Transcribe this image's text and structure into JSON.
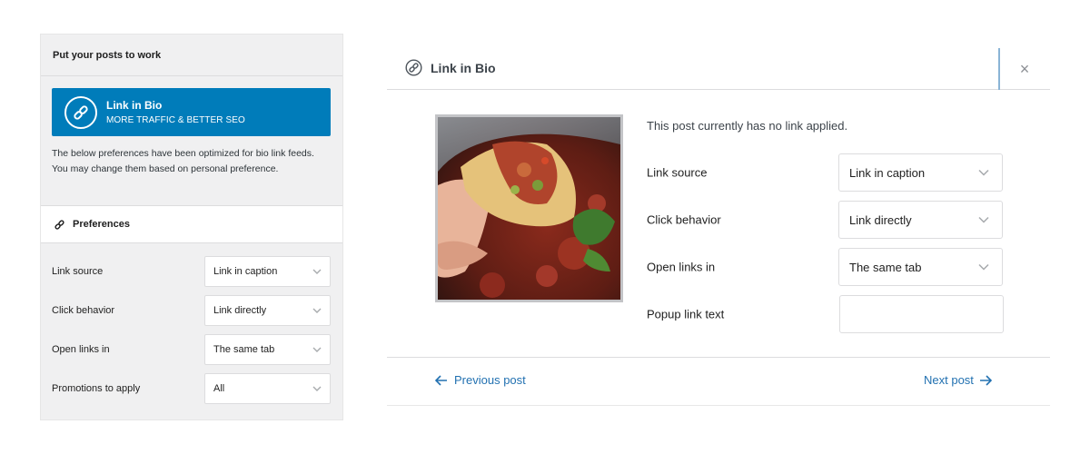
{
  "left_panel": {
    "title": "Put your posts to work",
    "promo": {
      "title": "Link in Bio",
      "subtitle": "MORE TRAFFIC & BETTER SEO",
      "icon": "link-circle-icon"
    },
    "description": "The below preferences have been optimized for bio link feeds. You may change them based on personal preference.",
    "preferences_header": "Preferences",
    "rows": [
      {
        "label": "Link source",
        "value": "Link in caption"
      },
      {
        "label": "Click behavior",
        "value": "Link directly"
      },
      {
        "label": "Open links in",
        "value": "The same tab"
      },
      {
        "label": "Promotions to apply",
        "value": "All"
      }
    ]
  },
  "modal": {
    "title": "Link in Bio",
    "close_icon": "×",
    "status": "This post currently has no link applied.",
    "rows": [
      {
        "label": "Link source",
        "value": "Link in caption"
      },
      {
        "label": "Click behavior",
        "value": "Link directly"
      },
      {
        "label": "Open links in",
        "value": "The same tab"
      }
    ],
    "popup_label": "Popup link text",
    "popup_value": "",
    "prev_label": "Previous post",
    "next_label": "Next post"
  },
  "colors": {
    "accent": "#007cba",
    "link": "#2271b1",
    "panel_bg": "#f0f0f1"
  }
}
